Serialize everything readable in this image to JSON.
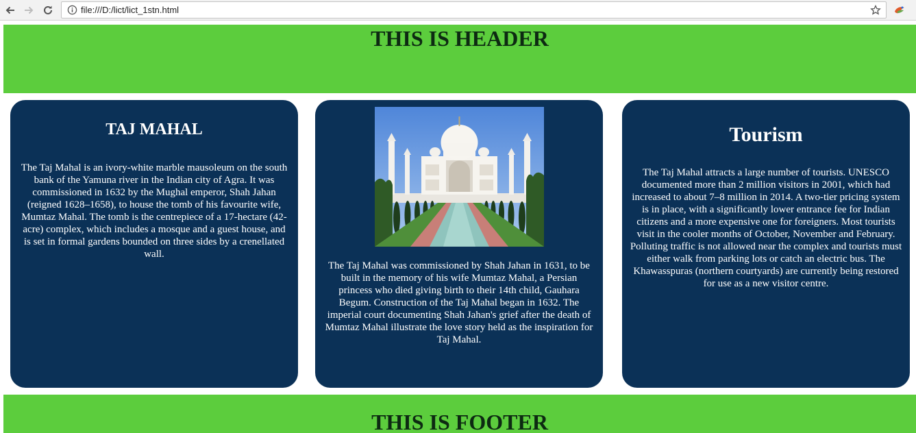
{
  "browser": {
    "url": "file:///D:/lict/lict_1stn.html"
  },
  "header": {
    "title": "THIS IS HEADER"
  },
  "cards": [
    {
      "title": "TAJ MAHAL",
      "text": "The Taj Mahal is an ivory-white marble mausoleum on the south bank of the Yamuna river in the Indian city of Agra. It was commissioned in 1632 by the Mughal emperor, Shah Jahan (reigned 1628–1658), to house the tomb of his favourite wife, Mumtaz Mahal. The tomb is the centrepiece of a 17-hectare (42-acre) complex, which includes a mosque and a guest house, and is set in formal gardens bounded on three sides by a crenellated wall."
    },
    {
      "text": "The Taj Mahal was commissioned by Shah Jahan in 1631, to be built in the memory of his wife Mumtaz Mahal, a Persian princess who died giving birth to their 14th child, Gauhara Begum. Construction of the Taj Mahal began in 1632. The imperial court documenting Shah Jahan's grief after the death of Mumtaz Mahal illustrate the love story held as the inspiration for Taj Mahal."
    },
    {
      "title": "Tourism",
      "text": "The Taj Mahal attracts a large number of tourists. UNESCO documented more than 2 million visitors in 2001, which had increased to about 7–8 million in 2014. A two-tier pricing system is in place, with a significantly lower entrance fee for Indian citizens and a more expensive one for foreigners. Most tourists visit in the cooler months of October, November and February. Polluting traffic is not allowed near the complex and tourists must either walk from parking lots or catch an electric bus. The Khawasspuras (northern courtyards) are currently being restored for use as a new visitor centre."
    }
  ],
  "footer": {
    "title": "THIS IS FOOTER"
  },
  "colors": {
    "header_bg": "#5ccd3d",
    "card_bg": "#0b3157",
    "heading_text": "#0d2a12"
  },
  "icons": [
    "back-arrow-icon",
    "forward-arrow-icon",
    "reload-icon",
    "info-icon",
    "star-icon",
    "extension-icon"
  ]
}
